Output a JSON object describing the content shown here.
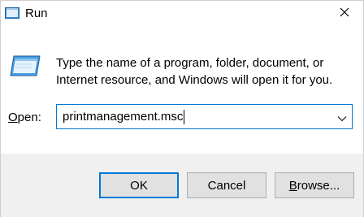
{
  "window": {
    "title": "Run",
    "title_icon": "run-icon",
    "close_icon": "close-icon"
  },
  "main": {
    "icon": "run-program-icon",
    "description": "Type the name of a program, folder, document, or Internet resource, and Windows will open it for you.",
    "open_label_prefix": "O",
    "open_label_rest": "pen:",
    "open_value": "printmanagement.msc",
    "dropdown_icon": "chevron-down-icon"
  },
  "buttons": {
    "ok": "OK",
    "cancel": "Cancel",
    "browse_underlined": "B",
    "browse_rest": "rowse..."
  },
  "colors": {
    "accent": "#0078d7",
    "footer_bg": "#f0f0f0",
    "button_bg": "#e1e1e1"
  }
}
